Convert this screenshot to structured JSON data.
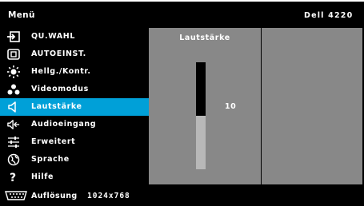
{
  "header": {
    "menu_title": "Menü",
    "model": "Dell 4220"
  },
  "sidebar": {
    "items": [
      {
        "label": "QU.WAHL",
        "icon": "input-source-icon"
      },
      {
        "label": "AUTOEINST.",
        "icon": "auto-adjust-icon"
      },
      {
        "label": "Hellg./Kontr.",
        "icon": "brightness-icon"
      },
      {
        "label": "Videomodus",
        "icon": "video-mode-icon"
      },
      {
        "label": "Lautstärke",
        "icon": "speaker-icon",
        "selected": true
      },
      {
        "label": "Audioeingang",
        "icon": "audio-input-icon"
      },
      {
        "label": "Erweitert",
        "icon": "advanced-settings-icon"
      },
      {
        "label": "Sprache",
        "icon": "language-icon"
      },
      {
        "label": "Hilfe",
        "icon": "help-icon"
      }
    ]
  },
  "panel": {
    "title": "Lautstärke",
    "value": "10",
    "level_fraction": 0.5
  },
  "footer": {
    "resolution_label": "Auflösung",
    "resolution_value": "1024x768",
    "icon": "video-port-icon"
  },
  "colors": {
    "highlight": "#00a0d8",
    "panel_gray": "#888888",
    "background": "#000000"
  }
}
